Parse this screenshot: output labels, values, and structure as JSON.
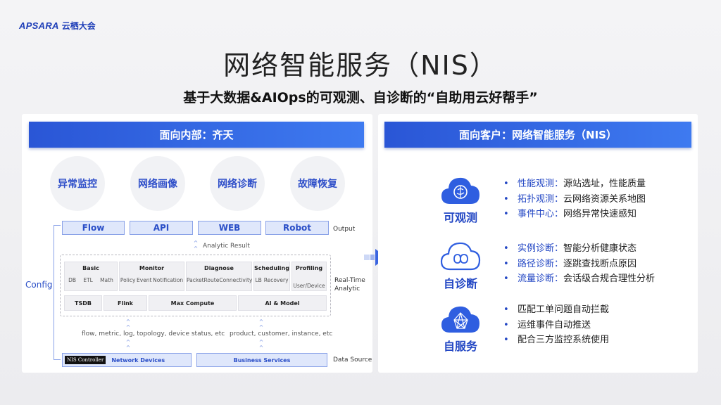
{
  "logo": {
    "en": "APSARA",
    "cn": "云栖大会"
  },
  "title": "网络智能服务（NIS）",
  "subtitle": "基于大数据&AIOps的可观测、自诊断的“自助用云好帮手”",
  "left": {
    "header": "面向内部：齐天",
    "circles": [
      "异常监控",
      "网络画像",
      "网络诊断",
      "故障恢复"
    ],
    "outputs": [
      "Flow",
      "API",
      "WEB",
      "Robot"
    ],
    "output_label": "Output",
    "analytic_result": "Analytic Result",
    "config_label": "Config",
    "realtime_label": "Real-Time Analytic",
    "modules": {
      "basic": {
        "title": "Basic",
        "items": [
          "DB",
          "ETL",
          "Math"
        ]
      },
      "monitor": {
        "title": "Monitor",
        "items": [
          "Policy",
          "Event",
          "Notification"
        ]
      },
      "diagnose": {
        "title": "Diagnose",
        "items": [
          "Packet",
          "Route",
          "Connectivity"
        ]
      },
      "scheduling": {
        "title": "Scheduling",
        "items": [
          "LB",
          "Recovery"
        ]
      },
      "profiling": {
        "title": "Profiling",
        "items": [
          "User/Device"
        ]
      }
    },
    "engines": [
      "TSDB",
      "Flink",
      "Max Compute",
      "AI & Model"
    ],
    "source_left_text": "flow, metric, log, topology, device status, etc",
    "source_right_text": "product, customer, instance, etc",
    "ds_controller": "NIS Controller",
    "ds_network": "Network Devices",
    "ds_business": "Business Services",
    "datasource_label": "Data Source"
  },
  "right": {
    "header": "面向客户：网络智能服务（NIS）",
    "groups": [
      {
        "name": "可观测",
        "icon": "brain-cloud-icon",
        "items": [
          {
            "k": "性能观测",
            "v": "源站选址，性能质量"
          },
          {
            "k": "拓扑观测",
            "v": "云网络资源关系地图"
          },
          {
            "k": "事件中心",
            "v": "网络异常快速感知"
          }
        ]
      },
      {
        "name": "自诊断",
        "icon": "infinity-cloud-icon",
        "items": [
          {
            "k": "实例诊断",
            "v": "智能分析健康状态"
          },
          {
            "k": "路径诊断",
            "v": "逐跳查找断点原因"
          },
          {
            "k": "流量诊断",
            "v": "会话级合规合理性分析"
          }
        ]
      },
      {
        "name": "自服务",
        "icon": "network-cloud-icon",
        "items": [
          {
            "k": "",
            "v": "匹配工单问题自动拦截"
          },
          {
            "k": "",
            "v": "运维事件自动推送"
          },
          {
            "k": "",
            "v": "配合三方监控系统使用"
          }
        ]
      }
    ]
  },
  "colors": {
    "accent": "#2a56d6",
    "text_blue": "#2347c4"
  }
}
